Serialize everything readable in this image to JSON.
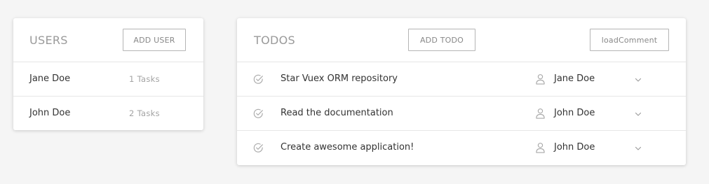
{
  "users": {
    "title": "USERS",
    "add_label": "ADD USER",
    "items": [
      {
        "name": "Jane Doe",
        "tasks": "1 Tasks"
      },
      {
        "name": "John Doe",
        "tasks": "2 Tasks"
      }
    ]
  },
  "todos": {
    "title": "TODOS",
    "add_label": "ADD TODO",
    "load_comment_label": "loadComment",
    "items": [
      {
        "title": "Star Vuex ORM repository",
        "assignee": "Jane Doe",
        "icon": "check-circle-icon"
      },
      {
        "title": "Read the documentation",
        "assignee": "John Doe",
        "icon": "check-circle-icon"
      },
      {
        "title": "Create awesome application!",
        "assignee": "John Doe",
        "icon": "check-circle-icon"
      }
    ]
  },
  "colors": {
    "background": "#f5f5f5",
    "card": "#ffffff",
    "muted_text": "#9a9a9a",
    "border": "#e6e6e6"
  }
}
